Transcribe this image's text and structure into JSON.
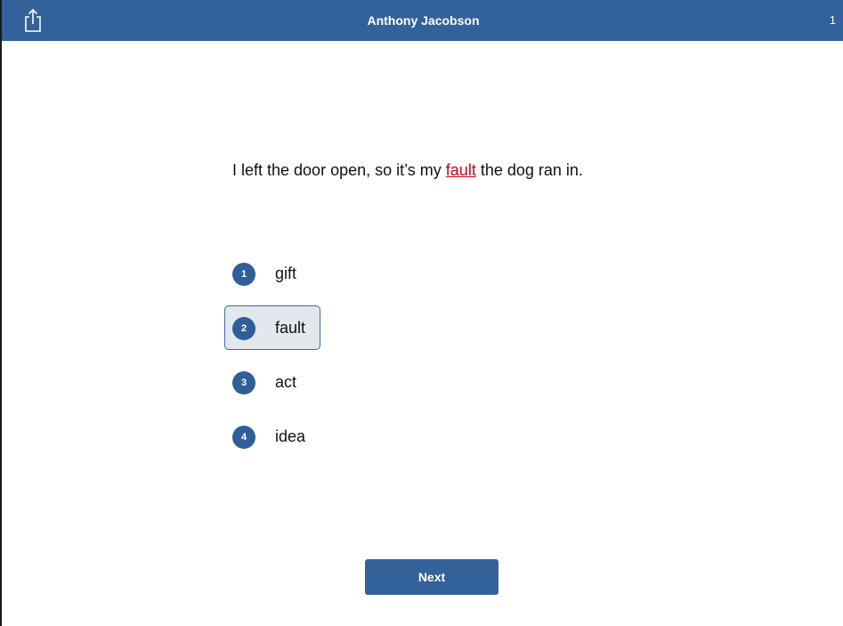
{
  "header": {
    "title": "Anthony Jacobson",
    "counter": "1",
    "share_icon": "share-icon"
  },
  "question": {
    "before": "I left the door open, so it’s my ",
    "highlight": "fault",
    "after": " the dog ran in."
  },
  "options": [
    {
      "number": "1",
      "label": "gift",
      "selected": false
    },
    {
      "number": "2",
      "label": "fault",
      "selected": true
    },
    {
      "number": "3",
      "label": "act",
      "selected": false
    },
    {
      "number": "4",
      "label": "idea",
      "selected": false
    }
  ],
  "footer": {
    "next_label": "Next"
  },
  "colors": {
    "brand": "#33619a",
    "highlight": "#d0021b",
    "selected_bg": "#e3e8ef"
  }
}
